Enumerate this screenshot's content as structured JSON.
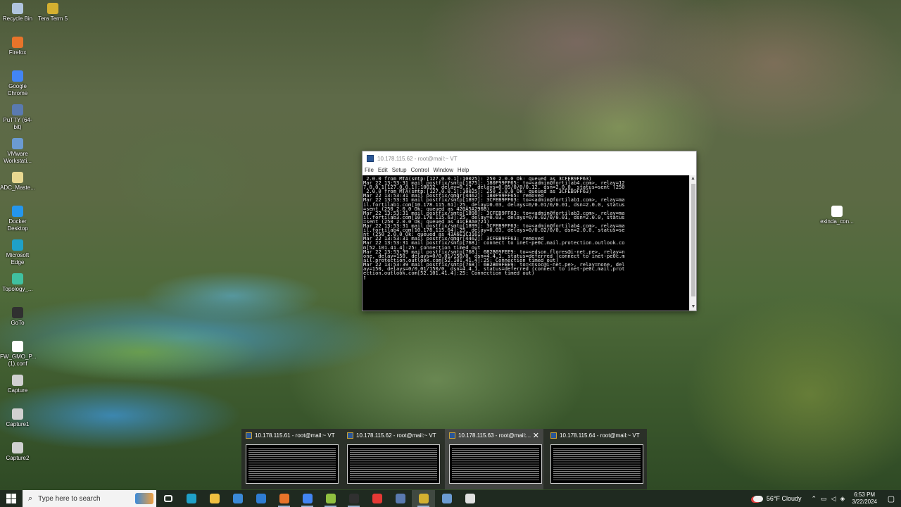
{
  "desktop_icons": [
    {
      "label": "Recycle Bin",
      "icon": "recycle-bin-icon",
      "color": "#b0c4de"
    },
    {
      "label": "Tera Term 5",
      "icon": "teraterm-icon",
      "color": "#d4b030"
    },
    {
      "label": "Firefox",
      "icon": "firefox-icon",
      "color": "#e8742a"
    },
    {
      "label": "Google Chrome",
      "icon": "chrome-icon",
      "color": "#4285f4"
    },
    {
      "label": "PuTTY (64-bit)",
      "icon": "putty-icon",
      "color": "#5a7ab0"
    },
    {
      "label": "VMware Workstati...",
      "icon": "vmware-icon",
      "color": "#6b9bd2"
    },
    {
      "label": "ADC_Maste...",
      "icon": "document-icon",
      "color": "#e8d890"
    },
    {
      "label": "Docker Desktop",
      "icon": "docker-icon",
      "color": "#2496ed"
    },
    {
      "label": "Microsoft Edge",
      "icon": "edge-icon",
      "color": "#1fa0c8"
    },
    {
      "label": "Topology_...",
      "icon": "topology-icon",
      "color": "#40c0a0"
    },
    {
      "label": "GoTo",
      "icon": "goto-icon",
      "color": "#303030"
    },
    {
      "label": "FW_GMO_P... (1).conf",
      "icon": "file-icon",
      "color": "#ffffff"
    },
    {
      "label": "Capture",
      "icon": "image-file-icon",
      "color": "#d0d0d0"
    },
    {
      "label": "Capture1",
      "icon": "image-file-icon",
      "color": "#d0d0d0"
    },
    {
      "label": "Capture2",
      "icon": "image-file-icon",
      "color": "#d0d0d0"
    },
    {
      "label": "exinda_con...",
      "icon": "file-icon",
      "color": "#ffffff"
    }
  ],
  "vt_window": {
    "title": "10.178.115.62 - root@mail:~ VT",
    "menu": [
      "File",
      "Edit",
      "Setup",
      "Control",
      "Window",
      "Help"
    ],
    "terminal_text": " 2.0.0 from MTA(smtp:[127.0.0.1]:10025): 250 2.0.0 Ok: queued as 3CFEB9FF63)\nMar 22 13:53:31 mail postfix/smtp[1875]: 180F99FF65: to=<admin@fortilab4.com>, relay=12\n7.0.0.1[127.0.0.1]:10032, delay=0.17, delays=0.05/0/0/0.12, dsn=2.0.0, status=sent (250\n 2.0.0 from MTA(smtp:[127.0.0.1]:10025): 250 2.0.0 Ok: queued as 3CFEB9FF63)\nMar 22 13:53:31 mail postfix/qmgr[4462]: 180F99FF65: removed\nMar 22 13:53:31 mail postfix/smtp[1897]: 3CFEB9FF63: to=<admin@fortilab1.com>, relay=ma\nil.fortilab1.com[10.178.115.61]:25, delay=0.03, delays=0/0.01/0/0.01, dsn=2.0.0, status\n=sent (250 2.0.0 Ok: queued as 420A5A296B)\nMar 22 13:53:31 mail postfix/smtp[1898]: 3CFEB9FF63: to=<admin@fortilab3.com>, relay=ma\nil.fortilab3.com[10.178.115.63]:25, delay=0.03, delays=0/0.02/0/0.01, dsn=2.0.0, status\n=sent (250 2.0.0 Ok: queued as 41CE8A0721)\nMar 22 13:53:31 mail postfix/smtp[1899]: 3CFEB9FF63: to=<admin@fortilab4.com>, relay=ma\nil.fortilab4.com[10.178.115.64]:25, delay=0.03, delays=0/0.02/0/0, dsn=2.0.0, status=se\nnt (250 2.0.0 Ok: queued as 43A6E1C3161)\nMar 22 13:53:31 mail postfix/qmgr[4462]: 3CFEB9FF63: removed\nMar 22 13:53:31 mail postfix/smtp[768]: connect to inet-pe0c.mail.protection.outlook.co\nm[52.101.41.4]:25: Connection timed out\nMar 22 13:53:39 mail postfix/smtp[768]: 6B2B69FEE9: to=<edson.flores@i-net.pe>, relay=n\none, delay=150, delays=0/0.01/150/0, dsn=4.4.1, status=deferred (connect to inet-pe0c.m\nail.protection.outlook.com[52.101.41.4]:25: Connection timed out)\nMar 22 13:53:39 mail postfix/smtp[768]: 6B2B69FEE9: to=<nsoc@i-net.pe>, relay=none, del\nay=150, delays=0/0.01/150/0, dsn=4.4.1, status=deferred (connect to inet-pe0c.mail.prot\nection.outlook.com[52.101.41.4]:25: Connection timed out)\n▯"
  },
  "taskbar_thumbnails": [
    {
      "title": "10.178.115.61 - root@mail:~ VT",
      "active": false
    },
    {
      "title": "10.178.115.62 - root@mail:~ VT",
      "active": false
    },
    {
      "title": "10.178.115.63 - root@mail:...",
      "active": true
    },
    {
      "title": "10.178.115.64 - root@mail:~ VT",
      "active": false
    }
  ],
  "taskbar": {
    "search_placeholder": "Type here to search",
    "pinned": [
      {
        "name": "task-view-icon",
        "color": "#ffffff"
      },
      {
        "name": "edge-icon",
        "color": "#1fa0c8"
      },
      {
        "name": "file-explorer-icon",
        "color": "#f0c040"
      },
      {
        "name": "store-icon",
        "color": "#3b8ad8"
      },
      {
        "name": "mail-icon",
        "color": "#2f7dd3"
      },
      {
        "name": "firefox-icon",
        "color": "#e8742a"
      },
      {
        "name": "chrome-icon",
        "color": "#4285f4"
      },
      {
        "name": "notepadpp-icon",
        "color": "#90c040"
      },
      {
        "name": "terminal-icon",
        "color": "#303030"
      },
      {
        "name": "anydesk-icon",
        "color": "#e53935"
      },
      {
        "name": "putty-icon",
        "color": "#5a7ab0"
      },
      {
        "name": "teraterm-icon",
        "color": "#d4b030"
      },
      {
        "name": "remote-desktop-icon",
        "color": "#6b9bd2"
      },
      {
        "name": "snipping-tool-icon",
        "color": "#e0e0e0"
      }
    ],
    "weather": "56°F  Cloudy",
    "time": "6:53 PM",
    "date": "3/22/2024"
  }
}
